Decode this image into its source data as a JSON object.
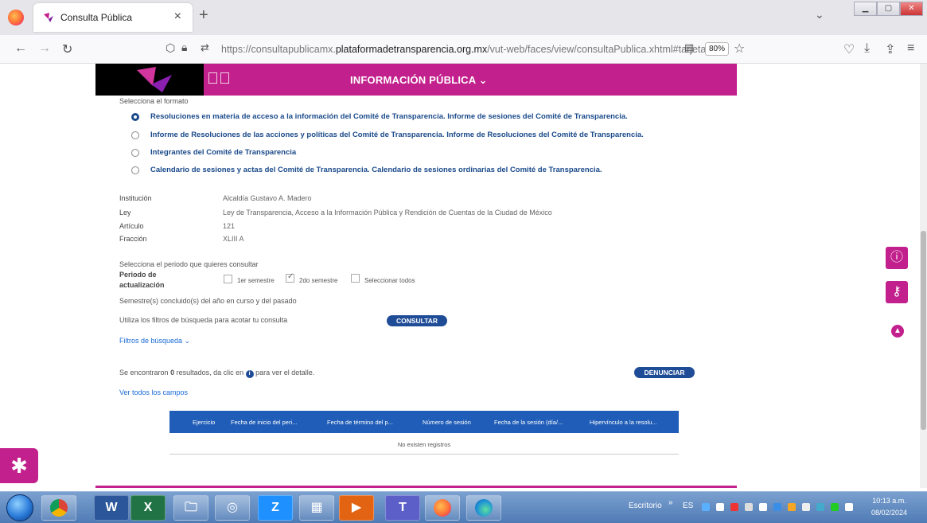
{
  "browser": {
    "tab_title": "Consulta Pública",
    "tab_close": "×",
    "new_tab": "+",
    "url_prefix": "https://consultapublicamx.",
    "url_domain": "plataformadetransparencia.org.mx",
    "url_suffix": "/vut-web/faces/view/consultaPublica.xhtml#tarjeta",
    "zoom": "80%"
  },
  "site": {
    "menu_label": "INFORMACIÓN PÚBLICA ⌄",
    "brand_color": "#c2208c"
  },
  "format": {
    "label": "Selecciona el formato",
    "options": [
      {
        "label": "Resoluciones en materia de acceso a la información del Comité de Transparencia. Informe de sesiones del Comité de Transparencia.",
        "selected": true
      },
      {
        "label": "Informe de Resoluciones de las acciones y políticas del Comité de Transparencia. Informe de Resoluciones del Comité de Transparencia.",
        "selected": false
      },
      {
        "label": "Integrantes del Comité de Transparencia",
        "selected": false
      },
      {
        "label": "Calendario de sesiones y actas del Comité de Transparencia. Calendario de sesiones ordinarias del Comité de Transparencia.",
        "selected": false
      }
    ]
  },
  "details": [
    {
      "key": "Institución",
      "value": "Alcaldía Gustavo A. Madero"
    },
    {
      "key": "Ley",
      "value": "Ley de Transparencia, Acceso a la Información Pública y Rendición de Cuentas de la Ciudad de México"
    },
    {
      "key": "Artículo",
      "value": "121"
    },
    {
      "key": "Fracción",
      "value": "XLIII A"
    }
  ],
  "period": {
    "prompt": "Selecciona el periodo que quieres consultar",
    "label_1": "Periodo de",
    "label_2": "actualización",
    "opt_1": "1er semestre",
    "opt_2": "2do semestre",
    "opt_3": "Seleccionar todos",
    "note": "Semestre(s) concluido(s) del año en curso y del pasado"
  },
  "search": {
    "hint": "Utiliza los filtros de búsqueda para acotar tu consulta",
    "consult_button": "CONSULTAR",
    "filters_link": "Filtros de búsqueda ⌄"
  },
  "results": {
    "text_before": "Se encontraron",
    "count": "0",
    "text_after": "resultados, da clic en",
    "text_end": "para ver el detalle.",
    "report_button": "DENUNCIAR",
    "all_fields_link": "Ver todos los campos"
  },
  "table": {
    "columns": [
      "Ejercicio",
      "Fecha de inicio del peri...",
      "Fecha de término del p...",
      "Número de sesión",
      "Fecha de la sesión (día/...",
      "Hipervínculo a la resolu..."
    ],
    "empty": "No existen registros"
  },
  "taskbar": {
    "desktop": "Escritorio",
    "lang": "ES",
    "time": "10:13 a.m.",
    "date": "08/02/2024"
  }
}
